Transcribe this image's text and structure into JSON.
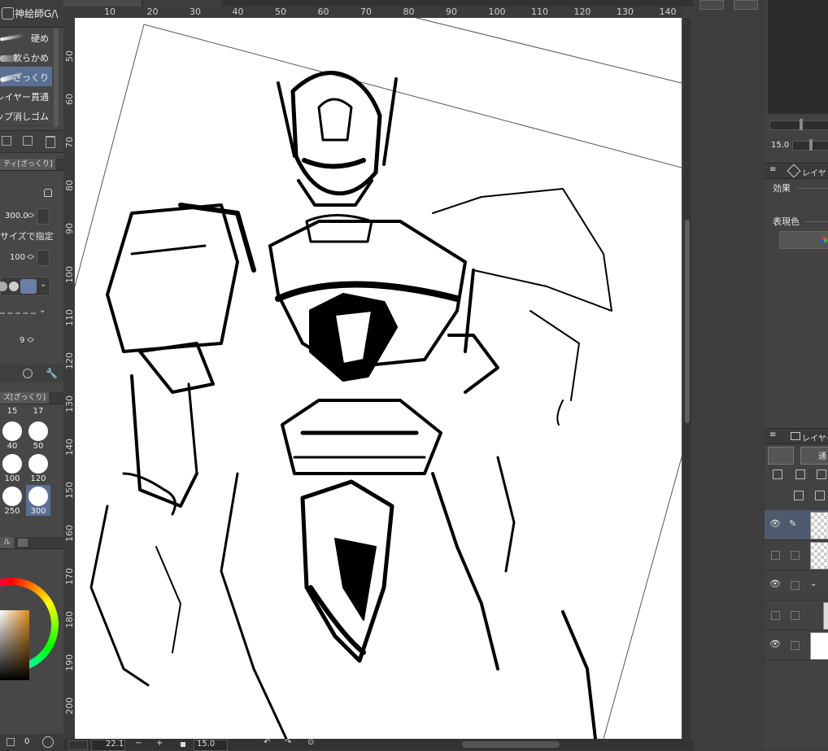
{
  "brush_palette": {
    "group_label": "神絵師G/\\",
    "items": [
      {
        "label": "硬め"
      },
      {
        "label": "軟らかめ"
      },
      {
        "label": "ざっくり",
        "selected": true
      },
      {
        "label": "レイヤー貫通"
      },
      {
        "label": "ップ消しゴム"
      }
    ]
  },
  "tool_property": {
    "tab_label": "ティ[ざっくり]",
    "brush_size": "300.0",
    "size_mode_label": "サイズで指定",
    "opacity": "100",
    "stabilization": "9"
  },
  "brush_size_palette": {
    "tab_label": "ズ[ざっくり]",
    "sizes": [
      "15",
      "17",
      "40",
      "50",
      "100",
      "120",
      "250",
      "300"
    ],
    "selected": "300"
  },
  "color_panel": {
    "tab_label": "ル"
  },
  "canvas": {
    "ruler_top": [
      "10",
      "20",
      "30",
      "40",
      "50",
      "60",
      "70",
      "80",
      "90",
      "100",
      "110",
      "120",
      "130",
      "140"
    ],
    "ruler_left": [
      "50",
      "60",
      "70",
      "80",
      "90",
      "100",
      "110",
      "120",
      "130",
      "140",
      "150",
      "160",
      "170",
      "180",
      "190",
      "200"
    ]
  },
  "status_bar": {
    "zoom": "22.1",
    "angle": "15.0"
  },
  "left_footer": {
    "value": "0"
  },
  "navigator": {
    "angle_value": "15.0"
  },
  "layer_property": {
    "tab_label": "レイヤ",
    "effect_label": "効果",
    "expression_color_label": "表現色"
  },
  "layer_panel": {
    "tab_label": "レイヤー",
    "blend_mode": "通"
  },
  "colors": {
    "accent": "#5b6f93",
    "background": "#3a3a3a"
  }
}
